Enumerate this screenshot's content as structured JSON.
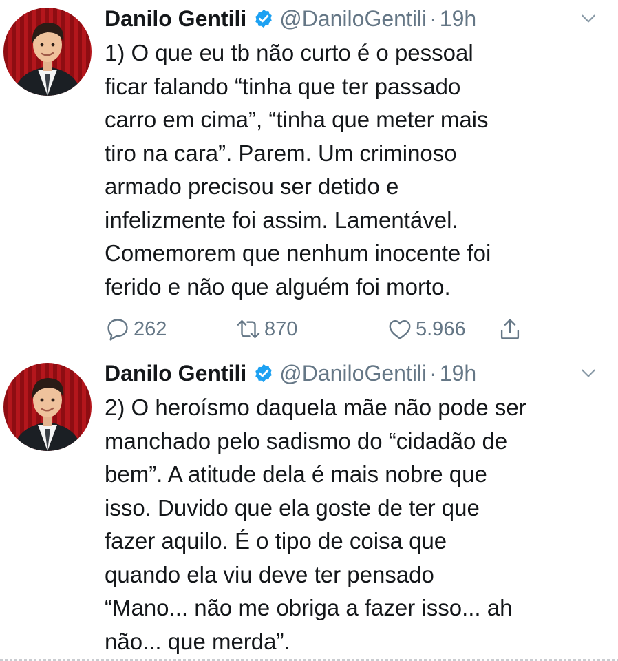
{
  "tweets": [
    {
      "author_name": "Danilo Gentili",
      "handle": "@DaniloGentili",
      "separator": "·",
      "time": "19h",
      "text_lines": [
        "1) O que eu tb não curto é o pessoal",
        "ficar falando “tinha que ter passado",
        "carro em cima”, “tinha que meter mais",
        "tiro na cara”. Parem. Um criminoso",
        "armado precisou ser detido e",
        "infelizmente foi assim. Lamentável.",
        "Comemorem que nenhum inocente foi",
        "ferido e não que alguém foi morto."
      ],
      "reply_count": "262",
      "retweet_count": "870",
      "like_count": "5.966"
    },
    {
      "author_name": "Danilo Gentili",
      "handle": "@DaniloGentili",
      "separator": "·",
      "time": "19h",
      "text_lines": [
        "2) O heroísmo daquela mãe não pode ser",
        "manchado pelo sadismo do “cidadão de",
        "bem”. A atitude dela é mais nobre que",
        "isso. Duvido que ela goste de ter que",
        "fazer aquilo. É o tipo de coisa que",
        "quando ela viu deve ter pensado",
        "“Mano... não me obriga a fazer isso... ah",
        "não... que merda”."
      ]
    }
  ],
  "icons": {
    "verified": "verified-badge-icon",
    "caret": "chevron-down-icon",
    "reply": "reply-icon",
    "retweet": "retweet-icon",
    "like": "heart-icon",
    "share": "share-icon"
  },
  "colors": {
    "text": "#14171a",
    "secondary": "#657786",
    "verified_blue": "#1da1f2",
    "avatar_curtain": "#a3141a"
  }
}
